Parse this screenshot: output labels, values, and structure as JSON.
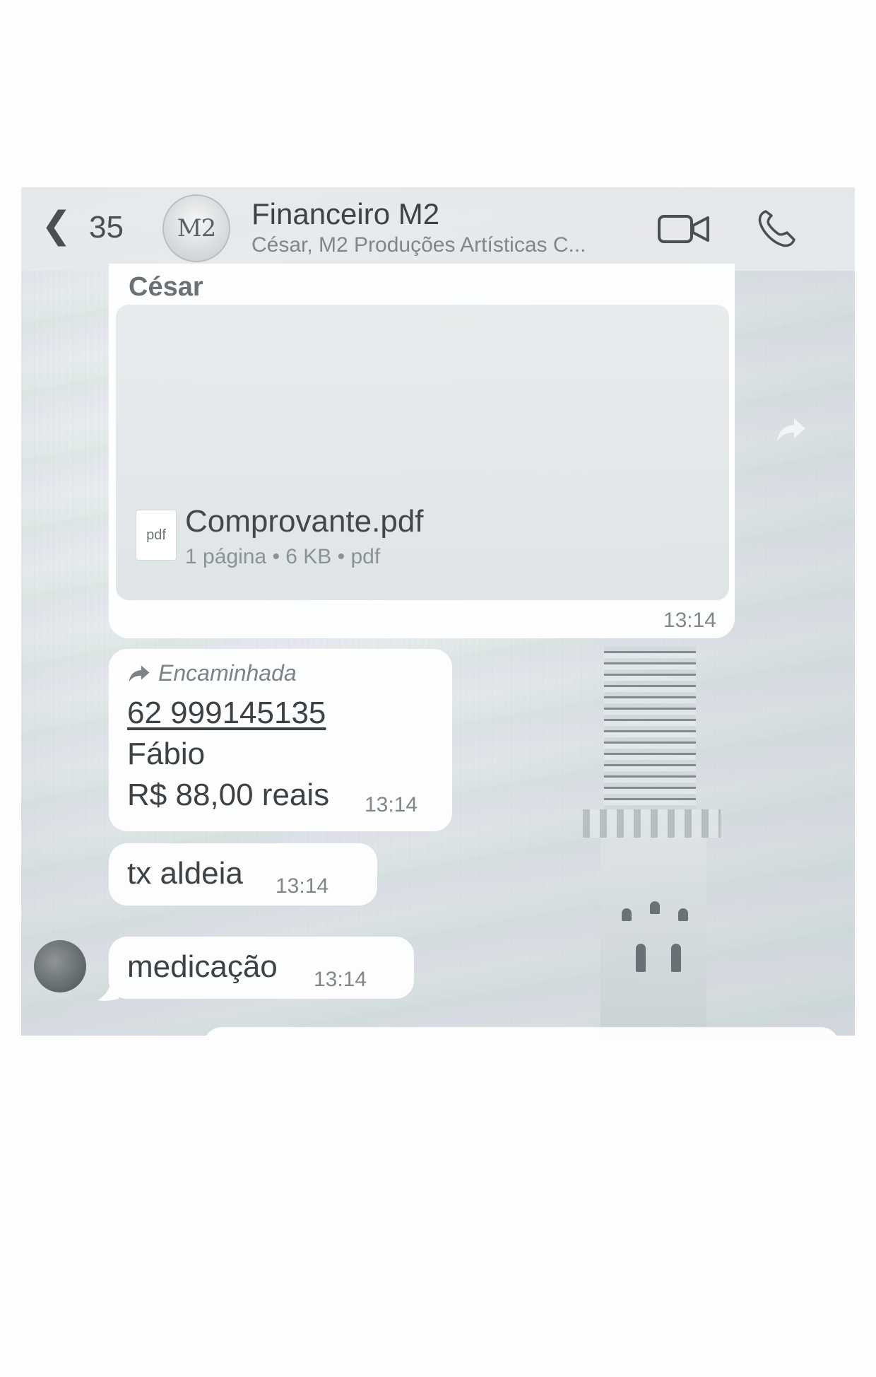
{
  "header": {
    "back_count": "35",
    "avatar_text": "M2",
    "title": "Financeiro M2",
    "subtitle": "César, M2 Produções Artísticas C..."
  },
  "messages": {
    "pdf": {
      "sender": "César",
      "file_icon_label": "pdf",
      "file_name": "Comprovante.pdf",
      "file_meta": "1 página • 6 KB • pdf",
      "time": "13:14"
    },
    "forwarded": {
      "label": "Encaminhada",
      "phone": "62 999145135",
      "name": "Fábio",
      "amount": "R$ 88,00 reais",
      "time": "13:14"
    },
    "tx": {
      "text": "tx aldeia",
      "time": "13:14"
    },
    "med": {
      "text": "medicação",
      "time": "13:14"
    }
  },
  "colors": {
    "bubble": "#ffffff",
    "text": "#3c4245",
    "muted": "#7f878a"
  }
}
